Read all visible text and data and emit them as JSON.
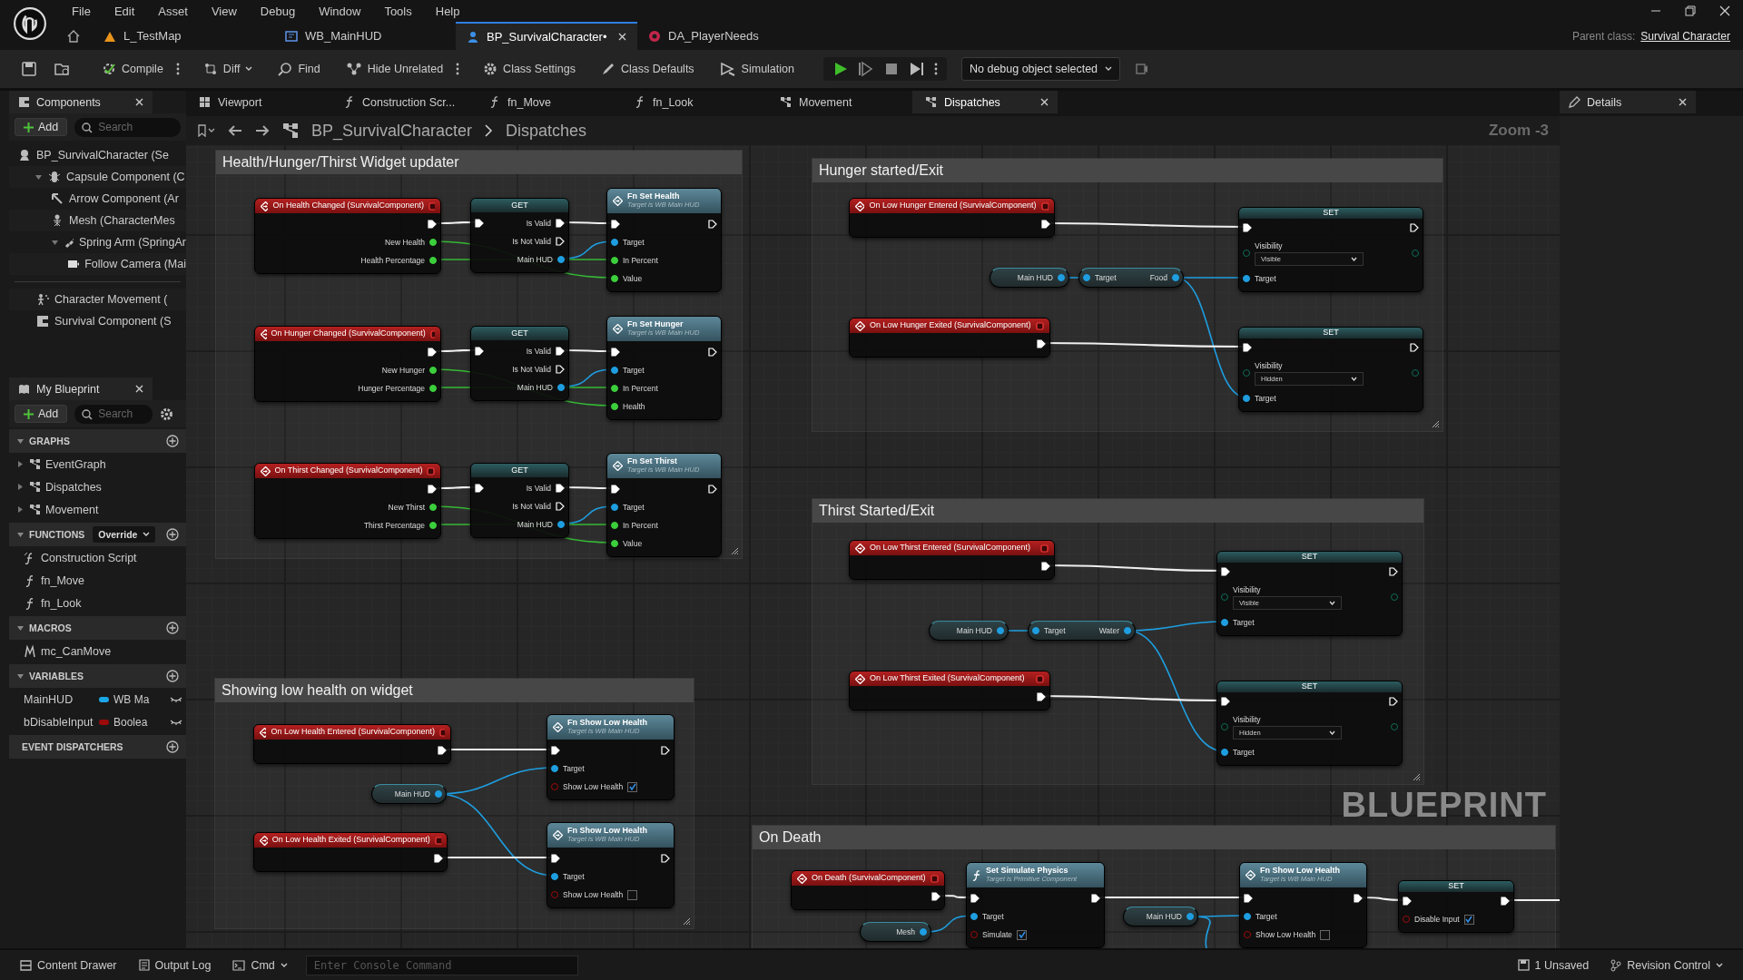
{
  "menu": [
    "File",
    "Edit",
    "Asset",
    "View",
    "Debug",
    "Window",
    "Tools",
    "Help"
  ],
  "document_tabs": [
    {
      "label": "L_TestMap",
      "kind": "level",
      "selected": false
    },
    {
      "label": "WB_MainHUD",
      "kind": "widget",
      "selected": false
    },
    {
      "label": "BP_SurvivalCharacter•",
      "kind": "blueprint",
      "selected": true
    },
    {
      "label": "DA_PlayerNeeds",
      "kind": "data_asset",
      "selected": false
    }
  ],
  "parent_class": {
    "label": "Parent class:",
    "value": "Survival Character"
  },
  "toolbar": {
    "buttons": [
      {
        "kind": "compile",
        "label": "Compile",
        "more": true,
        "dropdown": false
      },
      {
        "kind": "diff",
        "label": "Diff",
        "more": false,
        "dropdown": true
      },
      {
        "kind": "find",
        "label": "Find",
        "more": false,
        "dropdown": false
      },
      {
        "kind": "hide",
        "label": "Hide Unrelated",
        "more": true,
        "dropdown": false
      },
      {
        "kind": "settings",
        "label": "Class Settings",
        "more": false,
        "dropdown": false
      },
      {
        "kind": "defaults",
        "label": "Class Defaults",
        "more": false,
        "dropdown": false
      },
      {
        "kind": "simulation",
        "label": "Simulation",
        "more": false,
        "dropdown": false
      }
    ],
    "debug_object": "No debug object selected"
  },
  "components": {
    "title": "Components",
    "add": "Add",
    "search": {
      "placeholder": "Search"
    },
    "tree": [
      {
        "label": "BP_SurvivalCharacter (Se",
        "kind": "actor",
        "children": [
          {
            "label": "Capsule Component (C",
            "kind": "capsule",
            "expanded": true,
            "children": [
              {
                "label": "Arrow Component (Ar",
                "kind": "arrow"
              },
              {
                "label": "Mesh (CharacterMes",
                "kind": "mesh"
              },
              {
                "label": "Spring Arm (SpringAr",
                "kind": "spring",
                "expanded": true,
                "children": [
                  {
                    "label": "Follow Camera (Mai",
                    "kind": "camera"
                  }
                ]
              }
            ]
          }
        ]
      }
    ],
    "other": [
      {
        "label": "Character Movement (",
        "kind": "movement"
      },
      {
        "label": "Survival Component (S",
        "kind": "component"
      }
    ]
  },
  "my_blueprint": {
    "title": "My Blueprint",
    "add": "Add",
    "search": {
      "placeholder": "Search"
    },
    "sections": [
      {
        "title": "GRAPHS",
        "expanded": true,
        "items": [
          {
            "label": "EventGraph",
            "kind": "graph",
            "expanded": false
          },
          {
            "label": "Dispatches",
            "kind": "graph",
            "expanded": false
          },
          {
            "label": "Movement",
            "kind": "graph",
            "expanded": false
          }
        ]
      },
      {
        "title": "FUNCTIONS",
        "expanded": true,
        "override": "Override",
        "items": [
          {
            "label": "Construction Script",
            "kind": "construction"
          },
          {
            "label": "fn_Move",
            "kind": "function"
          },
          {
            "label": "fn_Look",
            "kind": "function"
          }
        ]
      },
      {
        "title": "MACROS",
        "expanded": true,
        "items": [
          {
            "label": "mc_CanMove",
            "kind": "macro"
          }
        ]
      },
      {
        "title": "VARIABLES",
        "expanded": true,
        "items": [
          {
            "label": "MainHUD",
            "kind": "variable",
            "type": "WB Ma",
            "color": "#1aa7e8"
          },
          {
            "label": "bDisableInput",
            "kind": "variable",
            "type": "Boolea",
            "color": "#9c0a0a"
          }
        ]
      },
      {
        "title": "EVENT DISPATCHERS"
      }
    ]
  },
  "editor_tabs": [
    {
      "label": "Viewport",
      "kind": "viewport",
      "selected": false
    },
    {
      "label": "Construction Scr...",
      "kind": "function",
      "selected": false
    },
    {
      "label": "fn_Move",
      "kind": "function",
      "selected": false
    },
    {
      "label": "fn_Look",
      "kind": "function",
      "selected": false
    },
    {
      "label": "Movement",
      "kind": "graph",
      "selected": false
    },
    {
      "label": "Dispatches",
      "kind": "graph",
      "selected": true
    }
  ],
  "details": {
    "title": "Details"
  },
  "breadcrumb": [
    "BP_SurvivalCharacter",
    "Dispatches"
  ],
  "zoom": "Zoom -3",
  "graph": {
    "watermark": "BLUEPRINT",
    "comments": [
      {
        "title": "Health/Hunger/Thirst Widget updater",
        "nodes": [
          {
            "kind": "event",
            "title": "On Health Changed (SurvivalComponent)",
            "rows": [
              {
                "out": {
                  "kind": "exec",
                  "linked": true
                }
              },
              {
                "out": {
                  "kind": "float",
                  "label": "New Health",
                  "linked": true
                }
              },
              {
                "out": {
                  "kind": "float",
                  "label": "Health Percentage",
                  "linked": true
                }
              }
            ]
          },
          {
            "kind": "get",
            "title": "GET",
            "rows": [
              {
                "in": {
                  "kind": "exec",
                  "linked": true
                },
                "out": {
                  "kind": "exec",
                  "label": "Is Valid",
                  "linked": true
                }
              },
              {
                "out": {
                  "kind": "exec",
                  "label": "Is Not Valid",
                  "linked": false
                }
              },
              {
                "out": {
                  "kind": "object",
                  "label": "Main HUD",
                  "linked": true
                }
              }
            ]
          },
          {
            "kind": "call",
            "title": "Fn Set Health",
            "subtitle": "Target is WB Main HUD",
            "rows": [
              {
                "in": {
                  "kind": "exec",
                  "linked": true
                },
                "out": {
                  "kind": "exec",
                  "linked": false
                }
              },
              {
                "in": {
                  "kind": "object",
                  "label": "Target",
                  "linked": true
                }
              },
              {
                "in": {
                  "kind": "float",
                  "label": "In Percent",
                  "linked": true
                }
              },
              {
                "in": {
                  "kind": "float",
                  "label": "Value",
                  "linked": true
                }
              }
            ]
          },
          {
            "kind": "event",
            "title": "On Hunger Changed (SurvivalComponent)",
            "rows": [
              {
                "out": {
                  "kind": "exec",
                  "linked": true
                }
              },
              {
                "out": {
                  "kind": "float",
                  "label": "New Hunger",
                  "linked": true
                }
              },
              {
                "out": {
                  "kind": "float",
                  "label": "Hunger Percentage",
                  "linked": true
                }
              }
            ]
          },
          {
            "kind": "get",
            "title": "GET",
            "rows": [
              {
                "in": {
                  "kind": "exec",
                  "linked": true
                },
                "out": {
                  "kind": "exec",
                  "label": "Is Valid",
                  "linked": true
                }
              },
              {
                "out": {
                  "kind": "exec",
                  "label": "Is Not Valid",
                  "linked": false
                }
              },
              {
                "out": {
                  "kind": "object",
                  "label": "Main HUD",
                  "linked": true
                }
              }
            ]
          },
          {
            "kind": "call",
            "title": "Fn Set Hunger",
            "subtitle": "Target is WB Main HUD",
            "rows": [
              {
                "in": {
                  "kind": "exec",
                  "linked": true
                },
                "out": {
                  "kind": "exec",
                  "linked": false
                }
              },
              {
                "in": {
                  "kind": "object",
                  "label": "Target",
                  "linked": true
                }
              },
              {
                "in": {
                  "kind": "float",
                  "label": "In Percent",
                  "linked": true
                }
              },
              {
                "in": {
                  "kind": "float",
                  "label": "Health",
                  "linked": true
                }
              }
            ]
          },
          {
            "kind": "event",
            "title": "On Thirst Changed (SurvivalComponent)",
            "rows": [
              {
                "out": {
                  "kind": "exec",
                  "linked": true
                }
              },
              {
                "out": {
                  "kind": "float",
                  "label": "New Thirst",
                  "linked": true
                }
              },
              {
                "out": {
                  "kind": "float",
                  "label": "Thirst Percentage",
                  "linked": true
                }
              }
            ]
          },
          {
            "kind": "get",
            "title": "GET",
            "rows": [
              {
                "in": {
                  "kind": "exec",
                  "linked": true
                },
                "out": {
                  "kind": "exec",
                  "label": "Is Valid",
                  "linked": true
                }
              },
              {
                "out": {
                  "kind": "exec",
                  "label": "Is Not Valid",
                  "linked": false
                }
              },
              {
                "out": {
                  "kind": "object",
                  "label": "Main HUD",
                  "linked": true
                }
              }
            ]
          },
          {
            "kind": "call",
            "title": "Fn Set Thirst",
            "subtitle": "Target is WB Main HUD",
            "rows": [
              {
                "in": {
                  "kind": "exec",
                  "linked": true
                },
                "out": {
                  "kind": "exec",
                  "linked": false
                }
              },
              {
                "in": {
                  "kind": "object",
                  "label": "Target",
                  "linked": true
                }
              },
              {
                "in": {
                  "kind": "float",
                  "label": "In Percent",
                  "linked": true
                }
              },
              {
                "in": {
                  "kind": "float",
                  "label": "Value",
                  "linked": true
                }
              }
            ]
          }
        ]
      },
      {
        "title": "Hunger started/Exit",
        "nodes": [
          {
            "kind": "event",
            "title": "On Low Hunger Entered (SurvivalComponent)",
            "rows": [
              {
                "out": {
                  "kind": "exec",
                  "linked": true
                }
              }
            ]
          },
          {
            "kind": "variable",
            "out": {
              "label": "Main HUD",
              "linked": true
            }
          },
          {
            "kind": "member",
            "in": {
              "label": "Target",
              "linked": true
            },
            "out": {
              "label": "Food",
              "linked": true
            }
          },
          {
            "kind": "set",
            "title": "SET",
            "rows": [
              {
                "in": {
                  "kind": "exec",
                  "linked": true
                },
                "out": {
                  "kind": "exec",
                  "linked": false
                }
              },
              {
                "in": {
                  "kind": "enum",
                  "label": "Visibility",
                  "value": "Visible",
                  "linked": false
                },
                "out": {
                  "kind": "enum",
                  "linked": false
                }
              },
              {
                "in": {
                  "kind": "object",
                  "label": "Target",
                  "linked": true
                }
              }
            ]
          },
          {
            "kind": "event",
            "title": "On Low Hunger Exited (SurvivalComponent)",
            "rows": [
              {
                "out": {
                  "kind": "exec",
                  "linked": true
                }
              }
            ]
          },
          {
            "kind": "set",
            "title": "SET",
            "rows": [
              {
                "in": {
                  "kind": "exec",
                  "linked": true
                },
                "out": {
                  "kind": "exec",
                  "linked": false
                }
              },
              {
                "in": {
                  "kind": "enum",
                  "label": "Visibility",
                  "value": "Hidden",
                  "linked": false
                },
                "out": {
                  "kind": "enum",
                  "linked": false
                }
              },
              {
                "in": {
                  "kind": "object",
                  "label": "Target",
                  "linked": true
                }
              }
            ]
          }
        ]
      },
      {
        "title": "Thirst Started/Exit",
        "nodes": [
          {
            "kind": "event",
            "title": "On Low Thirst Entered (SurvivalComponent)",
            "rows": [
              {
                "out": {
                  "kind": "exec",
                  "linked": true
                }
              }
            ]
          },
          {
            "kind": "variable",
            "out": {
              "label": "Main HUD",
              "linked": true
            }
          },
          {
            "kind": "member",
            "in": {
              "label": "Target",
              "linked": true
            },
            "out": {
              "label": "Water",
              "linked": true
            }
          },
          {
            "kind": "set",
            "title": "SET",
            "rows": [
              {
                "in": {
                  "kind": "exec",
                  "linked": true
                },
                "out": {
                  "kind": "exec",
                  "linked": false
                }
              },
              {
                "in": {
                  "kind": "enum",
                  "label": "Visibility",
                  "value": "Visible",
                  "linked": false
                },
                "out": {
                  "kind": "enum",
                  "linked": false
                }
              },
              {
                "in": {
                  "kind": "object",
                  "label": "Target",
                  "linked": true
                }
              }
            ]
          },
          {
            "kind": "event",
            "title": "On Low Thirst Exited (SurvivalComponent)",
            "rows": [
              {
                "out": {
                  "kind": "exec",
                  "linked": true
                }
              }
            ]
          },
          {
            "kind": "set",
            "title": "SET",
            "rows": [
              {
                "in": {
                  "kind": "exec",
                  "linked": true
                },
                "out": {
                  "kind": "exec",
                  "linked": false
                }
              },
              {
                "in": {
                  "kind": "enum",
                  "label": "Visibility",
                  "value": "Hidden",
                  "linked": false
                },
                "out": {
                  "kind": "enum",
                  "linked": false
                }
              },
              {
                "in": {
                  "kind": "object",
                  "label": "Target",
                  "linked": true
                }
              }
            ]
          }
        ]
      },
      {
        "title": "Showing low health on widget",
        "nodes": [
          {
            "kind": "event",
            "title": "On Low Health Entered (SurvivalComponent)",
            "rows": [
              {
                "out": {
                  "kind": "exec",
                  "linked": true
                }
              }
            ]
          },
          {
            "kind": "call",
            "title": "Fn Show Low Health",
            "subtitle": "Target is WB Main HUD",
            "rows": [
              {
                "in": {
                  "kind": "exec",
                  "linked": true
                },
                "out": {
                  "kind": "exec",
                  "linked": false
                }
              },
              {
                "in": {
                  "kind": "object",
                  "label": "Target",
                  "linked": true
                }
              },
              {
                "in": {
                  "kind": "bool",
                  "label": "Show Low Health",
                  "linked": false,
                  "checked": true
                }
              }
            ]
          },
          {
            "kind": "variable",
            "out": {
              "label": "Main HUD",
              "linked": true
            }
          },
          {
            "kind": "event",
            "title": "On Low Health Exited (SurvivalComponent)",
            "rows": [
              {
                "out": {
                  "kind": "exec",
                  "linked": true
                }
              }
            ]
          },
          {
            "kind": "call",
            "title": "Fn Show Low Health",
            "subtitle": "Target is WB Main HUD",
            "rows": [
              {
                "in": {
                  "kind": "exec",
                  "linked": true
                },
                "out": {
                  "kind": "exec",
                  "linked": false
                }
              },
              {
                "in": {
                  "kind": "object",
                  "label": "Target",
                  "linked": true
                }
              },
              {
                "in": {
                  "kind": "bool",
                  "label": "Show Low Health",
                  "linked": false,
                  "checked": false
                }
              }
            ]
          }
        ]
      },
      {
        "title": "On Death",
        "nodes": [
          {
            "kind": "event",
            "title": "On Death (SurvivalComponent)",
            "rows": [
              {
                "out": {
                  "kind": "exec",
                  "linked": true
                }
              }
            ]
          },
          {
            "kind": "variable",
            "out": {
              "label": "Mesh",
              "linked": true
            }
          },
          {
            "kind": "function",
            "title": "Set Simulate Physics",
            "subtitle": "Target is Primitive Component",
            "rows": [
              {
                "in": {
                  "kind": "exec",
                  "linked": true
                },
                "out": {
                  "kind": "exec",
                  "linked": true
                }
              },
              {
                "in": {
                  "kind": "object",
                  "label": "Target",
                  "linked": true
                }
              },
              {
                "in": {
                  "kind": "bool",
                  "label": "Simulate",
                  "linked": false,
                  "checked": true
                }
              }
            ]
          },
          {
            "kind": "variable",
            "out": {
              "label": "Main HUD",
              "linked": true
            }
          },
          {
            "kind": "call",
            "title": "Fn Show Low Health",
            "subtitle": "Target is WB Main HUD",
            "rows": [
              {
                "in": {
                  "kind": "exec",
                  "linked": true
                },
                "out": {
                  "kind": "exec",
                  "linked": true
                }
              },
              {
                "in": {
                  "kind": "object",
                  "label": "Target",
                  "linked": true
                }
              },
              {
                "in": {
                  "kind": "bool",
                  "label": "Show Low Health",
                  "linked": false,
                  "checked": false
                }
              }
            ]
          },
          {
            "kind": "set",
            "title": "SET",
            "rows": [
              {
                "in": {
                  "kind": "exec",
                  "linked": true
                },
                "out": {
                  "kind": "exec",
                  "linked": true
                }
              },
              {
                "in": {
                  "kind": "bool",
                  "label": "Disable Input",
                  "linked": false,
                  "checked": true
                }
              }
            ]
          }
        ]
      }
    ]
  },
  "status_bar": {
    "content_drawer": "Content Drawer",
    "output_log": "Output Log",
    "cmd": "Cmd",
    "console": {
      "placeholder": "Enter Console Command"
    },
    "unsaved": "1 Unsaved",
    "revision_control": "Revision Control"
  }
}
